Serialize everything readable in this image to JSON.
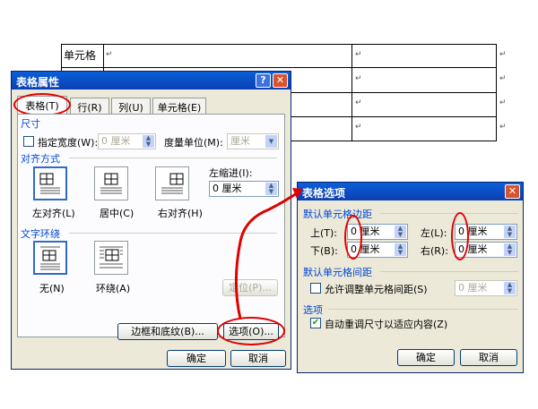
{
  "document": {
    "cell_label": "单元格",
    "cell_mark": "↵"
  },
  "table_properties": {
    "title": "表格属性",
    "help_btn": "?",
    "close_btn": "✕",
    "tabs": [
      "表格(T)",
      "行(R)",
      "列(U)",
      "单元格(E)"
    ],
    "size_group": "尺寸",
    "width_label": "指定宽度(W):",
    "width_value": "0 厘米",
    "unit_label": "度量单位(M):",
    "unit_value": "厘米",
    "align_group": "对齐方式",
    "align_left": "左对齐(L)",
    "align_center": "居中(C)",
    "align_right": "右对齐(H)",
    "indent_label": "左缩进(I):",
    "indent_value": "0 厘米",
    "wrap_group": "文字环绕",
    "wrap_none": "无(N)",
    "wrap_around": "环绕(A)",
    "position_btn": "定位(P)...",
    "borders_btn": "边框和底纹(B)...",
    "options_btn": "选项(O)...",
    "ok_btn": "确定",
    "cancel_btn": "取消"
  },
  "table_options": {
    "title": "表格选项",
    "close_btn": "✕",
    "margins_group": "默认单元格边距",
    "top_label": "上(T):",
    "top_value": "0 厘米",
    "left_label": "左(L):",
    "left_value": "0 厘米",
    "bottom_label": "下(B):",
    "bottom_value": "0 厘米",
    "right_label": "右(R):",
    "right_value": "0 厘米",
    "spacing_group": "默认单元格间距",
    "allow_spacing_label": "允许调整单元格间距(S)",
    "spacing_value": "0 厘米",
    "options_group": "选项",
    "autofit_label": "自动重调尺寸以适应内容(Z)",
    "ok_btn": "确定",
    "cancel_btn": "取消"
  },
  "colors": {
    "annotation": "#e00000",
    "titlebar": "#0a5fd8"
  }
}
